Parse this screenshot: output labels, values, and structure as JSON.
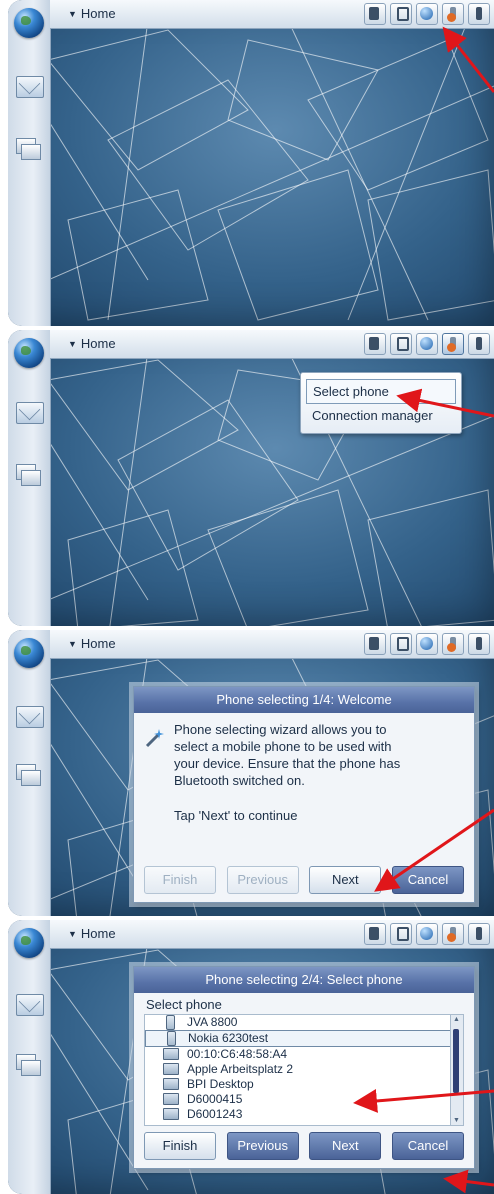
{
  "colors": {
    "desktop": "#34628a",
    "title_bar": "#5872a8",
    "arrow": "#e0161a"
  },
  "screen1": {
    "topbar": {
      "home_label": "Home"
    },
    "status_icons": [
      "bluetooth-icon",
      "battery-icon",
      "internet-globe-icon",
      "phone-connection-icon",
      "volume-icon"
    ]
  },
  "screen2": {
    "topbar": {
      "home_label": "Home"
    },
    "menu": {
      "items": [
        "Select phone",
        "Connection manager"
      ],
      "selected": "Select phone"
    }
  },
  "screen3": {
    "topbar": {
      "home_label": "Home"
    },
    "dialog": {
      "title": "Phone selecting 1/4: Welcome",
      "lines": [
        "Phone selecting wizard allows you to",
        "select a mobile phone to be used with",
        "your device. Ensure that the phone has",
        "Bluetooth switched on."
      ],
      "hint": "Tap 'Next' to continue",
      "buttons": {
        "finish": "Finish",
        "previous": "Previous",
        "next": "Next",
        "cancel": "Cancel"
      }
    }
  },
  "screen4": {
    "topbar": {
      "home_label": "Home"
    },
    "dialog": {
      "title": "Phone selecting 2/4: Select phone",
      "list_label": "Select phone",
      "devices": [
        "JVA 8800",
        "Nokia 6230test",
        "00:10:C6:48:58:A4",
        "Apple Arbeitsplatz 2",
        "BPI Desktop",
        "D6000415",
        "D6001243"
      ],
      "selected_device": "Nokia 6230test",
      "buttons": {
        "finish": "Finish",
        "previous": "Previous",
        "next": "Next",
        "cancel": "Cancel"
      }
    }
  }
}
